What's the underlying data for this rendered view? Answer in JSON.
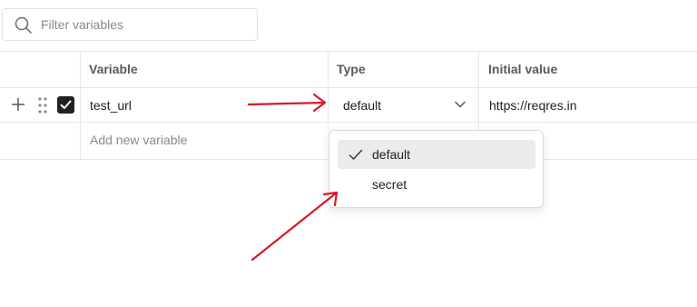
{
  "filter": {
    "placeholder": "Filter variables",
    "icon": "search-icon"
  },
  "table": {
    "headers": {
      "variable": "Variable",
      "type": "Type",
      "initial_value": "Initial value"
    },
    "rows": [
      {
        "enabled": true,
        "variable": "test_url",
        "type": "default",
        "initial_value": "https://reqres.in"
      }
    ],
    "add_new_placeholder": "Add new variable"
  },
  "type_dropdown": {
    "options": [
      {
        "label": "default",
        "selected": true
      },
      {
        "label": "secret",
        "selected": false
      }
    ]
  },
  "annotation_color": "#d9182c"
}
